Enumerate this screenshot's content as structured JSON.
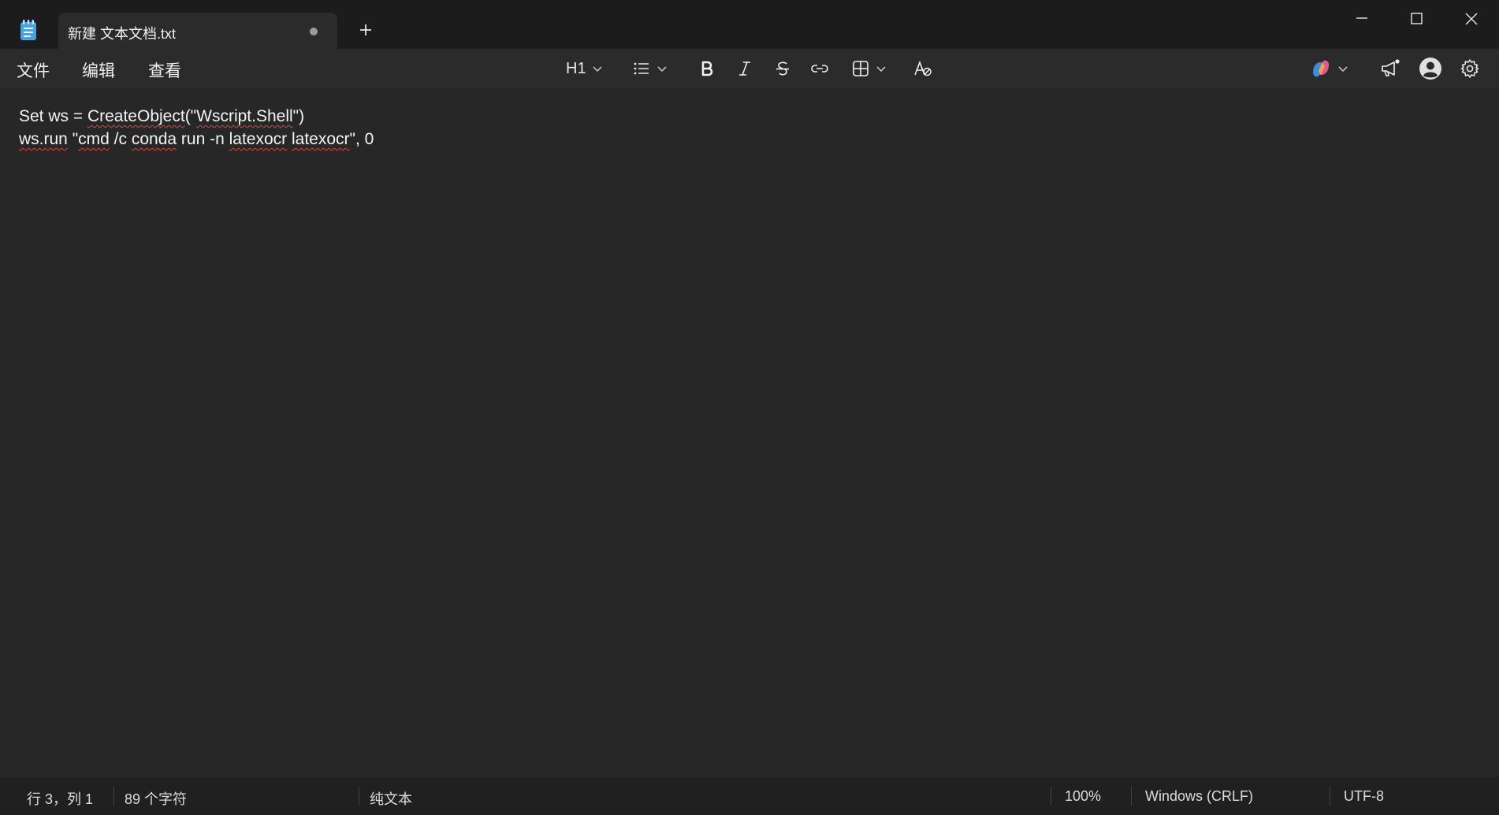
{
  "tab": {
    "title": "新建 文本文档.txt"
  },
  "menu": {
    "file": "文件",
    "edit": "编辑",
    "view": "查看"
  },
  "toolbar": {
    "heading_label": "H1",
    "icons": [
      "list-icon",
      "bold-icon",
      "italic-icon",
      "strikethrough-icon",
      "link-icon",
      "table-icon",
      "clear-formatting-icon",
      "copilot-icon",
      "feedback-icon",
      "account-icon",
      "settings-icon"
    ]
  },
  "editor": {
    "line1": {
      "p1": "Set ws = ",
      "sq1": "CreateObject",
      "p2": "(\"",
      "sq2": "Wscript.Shell",
      "p3": "\")"
    },
    "line2": {
      "sq1": "ws.run",
      "p1": " \"",
      "sq2": "cmd",
      "p2": " /c ",
      "sq3": "conda",
      "p3": " run -n ",
      "sq4": "latexocr",
      "p4": " ",
      "sq5": "latexocr",
      "p5": "\", 0"
    }
  },
  "status": {
    "position": "行 3，列 1",
    "chars": "89 个字符",
    "format": "纯文本",
    "zoom": "100%",
    "line_ending": "Windows (CRLF)",
    "encoding": "UTF-8"
  },
  "colors": {
    "background": "#272727",
    "titlebar": "#1c1c1c",
    "squiggle": "#e0463c",
    "accent_icon": "#4aa3df"
  }
}
